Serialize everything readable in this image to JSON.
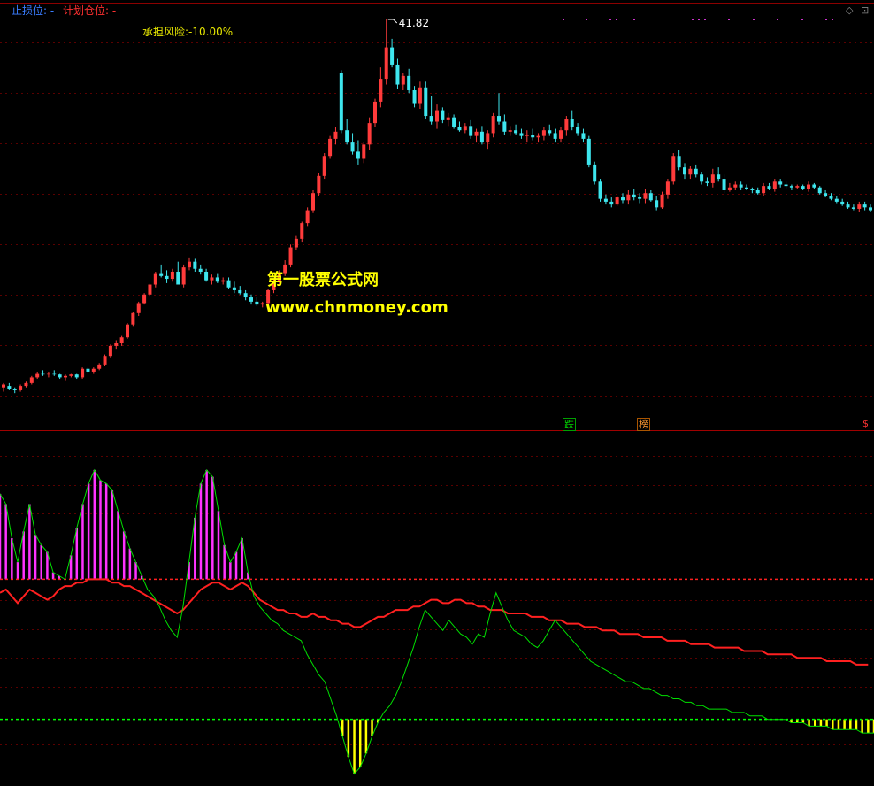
{
  "header": {
    "stop_loss_label": "止损位:",
    "stop_loss_value": "-",
    "plan_position_label": "计划仓位:",
    "plan_position_value": "-",
    "risk_text": "承担风险:-10.00%",
    "stop_loss_color": "#3a7dff",
    "plan_position_color": "#ff3030"
  },
  "watermark": {
    "name": "第一股票公式网",
    "url": "www.chnmoney.com"
  },
  "signals": {
    "fall": "跌",
    "list": "榜",
    "dollar": "$"
  },
  "window_controls": {
    "diamond": "◇",
    "maximize": "⊡"
  },
  "chart_data": [
    {
      "type": "candlestick",
      "max_label": "41.82",
      "ylim": [
        14,
        42.5
      ],
      "up_color": "#ff3b3b",
      "down_color": "#3ee6ee",
      "grid": true,
      "candles": [
        [
          16.0,
          16.3,
          15.7,
          16.2
        ],
        [
          16.1,
          16.3,
          15.8,
          15.9
        ],
        [
          15.9,
          16.0,
          15.6,
          15.8
        ],
        [
          15.8,
          16.2,
          15.7,
          16.1
        ],
        [
          16.1,
          16.4,
          16.0,
          16.3
        ],
        [
          16.3,
          16.8,
          16.2,
          16.7
        ],
        [
          16.7,
          17.1,
          16.6,
          17.0
        ],
        [
          17.0,
          17.2,
          16.8,
          16.9
        ],
        [
          16.9,
          17.1,
          16.7,
          17.0
        ],
        [
          17.0,
          17.2,
          16.8,
          16.9
        ],
        [
          16.9,
          17.0,
          16.6,
          16.7
        ],
        [
          16.7,
          16.9,
          16.5,
          16.8
        ],
        [
          16.8,
          17.0,
          16.7,
          16.9
        ],
        [
          16.9,
          17.0,
          16.6,
          16.7
        ],
        [
          16.7,
          17.4,
          16.6,
          17.3
        ],
        [
          17.3,
          17.4,
          17.0,
          17.1
        ],
        [
          17.1,
          17.4,
          17.0,
          17.3
        ],
        [
          17.3,
          17.7,
          17.2,
          17.6
        ],
        [
          17.6,
          18.3,
          17.5,
          18.2
        ],
        [
          18.2,
          19.0,
          18.1,
          18.9
        ],
        [
          18.9,
          19.3,
          18.7,
          19.1
        ],
        [
          19.1,
          19.6,
          18.9,
          19.5
        ],
        [
          19.5,
          20.5,
          19.4,
          20.4
        ],
        [
          20.4,
          21.3,
          20.3,
          21.2
        ],
        [
          21.2,
          22.0,
          21.0,
          21.9
        ],
        [
          21.9,
          22.6,
          21.8,
          22.5
        ],
        [
          22.5,
          23.3,
          22.3,
          23.2
        ],
        [
          23.2,
          24.1,
          23.0,
          24.0
        ],
        [
          24.0,
          24.6,
          23.7,
          23.8
        ],
        [
          23.8,
          24.2,
          23.3,
          23.6
        ],
        [
          23.6,
          24.3,
          23.4,
          24.1
        ],
        [
          24.1,
          24.8,
          23.5,
          23.2
        ],
        [
          23.2,
          24.6,
          23.0,
          24.4
        ],
        [
          24.4,
          25.1,
          24.2,
          24.8
        ],
        [
          24.8,
          25.0,
          24.1,
          24.3
        ],
        [
          24.3,
          24.6,
          23.9,
          24.1
        ],
        [
          24.1,
          24.3,
          23.4,
          23.5
        ],
        [
          23.5,
          23.9,
          23.2,
          23.7
        ],
        [
          23.7,
          24.0,
          23.3,
          23.4
        ],
        [
          23.4,
          23.7,
          23.2,
          23.5
        ],
        [
          23.5,
          23.7,
          22.9,
          23.0
        ],
        [
          23.0,
          23.4,
          22.6,
          22.8
        ],
        [
          22.8,
          23.1,
          22.5,
          22.6
        ],
        [
          22.6,
          22.8,
          22.1,
          22.3
        ],
        [
          22.3,
          22.5,
          21.8,
          22.0
        ],
        [
          22.0,
          22.3,
          21.7,
          21.8
        ],
        [
          21.8,
          22.0,
          21.6,
          21.9
        ],
        [
          21.9,
          22.9,
          21.8,
          22.8
        ],
        [
          22.8,
          23.6,
          22.6,
          23.4
        ],
        [
          23.4,
          24.2,
          23.2,
          24.0
        ],
        [
          24.0,
          24.9,
          23.8,
          24.6
        ],
        [
          24.6,
          26.0,
          24.4,
          25.8
        ],
        [
          25.8,
          26.6,
          25.6,
          26.4
        ],
        [
          26.4,
          27.6,
          26.2,
          27.5
        ],
        [
          27.5,
          28.6,
          27.3,
          28.4
        ],
        [
          28.4,
          29.8,
          28.2,
          29.6
        ],
        [
          29.6,
          31.0,
          29.4,
          30.8
        ],
        [
          30.8,
          32.4,
          30.6,
          32.2
        ],
        [
          32.2,
          33.6,
          32.0,
          33.4
        ],
        [
          33.4,
          34.2,
          33.0,
          33.9
        ],
        [
          38.0,
          38.2,
          33.8,
          34.0
        ],
        [
          34.0,
          34.8,
          33.0,
          33.2
        ],
        [
          33.2,
          33.8,
          32.3,
          32.5
        ],
        [
          32.5,
          33.3,
          31.6,
          32.0
        ],
        [
          32.0,
          33.2,
          31.7,
          33.0
        ],
        [
          33.0,
          34.9,
          32.6,
          34.5
        ],
        [
          34.5,
          36.2,
          34.2,
          36.0
        ],
        [
          36.0,
          38.4,
          35.6,
          37.6
        ],
        [
          37.6,
          41.82,
          37.2,
          39.8
        ],
        [
          39.8,
          40.4,
          38.4,
          38.6
        ],
        [
          38.6,
          39.0,
          36.9,
          37.2
        ],
        [
          37.2,
          38.0,
          36.8,
          37.8
        ],
        [
          37.8,
          38.3,
          36.6,
          36.8
        ],
        [
          36.8,
          37.1,
          35.6,
          35.9
        ],
        [
          35.9,
          37.4,
          35.5,
          37.0
        ],
        [
          37.0,
          37.4,
          34.8,
          35.0
        ],
        [
          35.0,
          36.4,
          34.4,
          34.6
        ],
        [
          34.6,
          35.8,
          34.1,
          35.4
        ],
        [
          35.4,
          35.6,
          34.5,
          34.7
        ],
        [
          34.7,
          35.2,
          34.3,
          34.9
        ],
        [
          34.9,
          35.1,
          34.1,
          34.2
        ],
        [
          34.2,
          34.6,
          33.9,
          34.0
        ],
        [
          34.0,
          34.5,
          33.8,
          34.3
        ],
        [
          34.3,
          34.7,
          33.4,
          33.6
        ],
        [
          33.6,
          34.1,
          33.2,
          33.9
        ],
        [
          33.9,
          34.3,
          33.0,
          33.2
        ],
        [
          33.2,
          34.0,
          32.7,
          33.8
        ],
        [
          33.8,
          35.2,
          33.5,
          35.0
        ],
        [
          35.0,
          36.6,
          34.4,
          34.6
        ],
        [
          34.6,
          35.1,
          33.7,
          33.9
        ],
        [
          33.9,
          34.3,
          33.6,
          34.0
        ],
        [
          34.0,
          34.4,
          33.7,
          33.8
        ],
        [
          33.8,
          34.1,
          33.4,
          33.6
        ],
        [
          33.6,
          34.0,
          33.2,
          33.7
        ],
        [
          33.7,
          34.1,
          33.3,
          33.5
        ],
        [
          33.5,
          33.8,
          33.2,
          33.6
        ],
        [
          33.6,
          34.2,
          33.3,
          34.0
        ],
        [
          34.0,
          34.4,
          33.6,
          33.8
        ],
        [
          33.8,
          34.1,
          33.2,
          33.4
        ],
        [
          33.4,
          34.2,
          33.2,
          34.0
        ],
        [
          34.0,
          35.0,
          33.6,
          34.8
        ],
        [
          34.8,
          35.4,
          34.0,
          34.2
        ],
        [
          34.2,
          34.5,
          33.6,
          33.8
        ],
        [
          33.8,
          34.1,
          33.2,
          33.4
        ],
        [
          33.4,
          33.6,
          31.4,
          31.6
        ],
        [
          31.6,
          31.8,
          30.2,
          30.4
        ],
        [
          30.4,
          30.6,
          29.0,
          29.2
        ],
        [
          29.2,
          29.5,
          28.8,
          29.0
        ],
        [
          29.0,
          29.3,
          28.6,
          28.8
        ],
        [
          28.8,
          29.4,
          28.7,
          29.3
        ],
        [
          29.3,
          29.6,
          28.9,
          29.1
        ],
        [
          29.1,
          29.8,
          28.8,
          29.5
        ],
        [
          29.5,
          29.9,
          29.1,
          29.3
        ],
        [
          29.3,
          29.6,
          28.9,
          29.2
        ],
        [
          29.2,
          29.9,
          28.9,
          29.6
        ],
        [
          29.6,
          29.8,
          29.0,
          29.1
        ],
        [
          29.1,
          29.4,
          28.4,
          28.6
        ],
        [
          28.6,
          29.7,
          28.5,
          29.5
        ],
        [
          29.5,
          30.6,
          29.2,
          30.4
        ],
        [
          30.4,
          32.4,
          30.2,
          32.2
        ],
        [
          32.2,
          32.6,
          31.2,
          31.4
        ],
        [
          31.4,
          31.7,
          30.6,
          30.9
        ],
        [
          30.9,
          31.5,
          30.6,
          31.3
        ],
        [
          31.3,
          31.6,
          30.7,
          30.9
        ],
        [
          30.9,
          31.1,
          30.2,
          30.4
        ],
        [
          30.4,
          30.7,
          30.1,
          30.3
        ],
        [
          30.3,
          31.3,
          30.0,
          30.9
        ],
        [
          30.9,
          31.4,
          30.4,
          30.6
        ],
        [
          30.6,
          30.9,
          29.6,
          29.8
        ],
        [
          29.8,
          30.3,
          29.7,
          30.0
        ],
        [
          30.0,
          30.4,
          29.8,
          30.2
        ],
        [
          30.2,
          30.4,
          29.8,
          30.0
        ],
        [
          30.0,
          30.2,
          29.8,
          29.9
        ],
        [
          29.9,
          30.0,
          29.6,
          29.8
        ],
        [
          29.8,
          30.0,
          29.5,
          29.6
        ],
        [
          29.6,
          30.3,
          29.4,
          30.1
        ],
        [
          30.1,
          30.3,
          29.8,
          29.9
        ],
        [
          29.9,
          30.6,
          29.7,
          30.4
        ],
        [
          30.4,
          30.6,
          30.0,
          30.2
        ],
        [
          30.2,
          30.4,
          29.9,
          30.1
        ],
        [
          30.1,
          30.2,
          29.8,
          30.0
        ],
        [
          30.0,
          30.2,
          29.9,
          30.1
        ],
        [
          30.1,
          30.2,
          29.8,
          29.9
        ],
        [
          29.9,
          30.4,
          29.7,
          30.2
        ],
        [
          30.2,
          30.3,
          29.9,
          30.0
        ],
        [
          30.0,
          30.1,
          29.5,
          29.6
        ],
        [
          29.6,
          29.8,
          29.3,
          29.4
        ],
        [
          29.4,
          29.6,
          29.1,
          29.2
        ],
        [
          29.2,
          29.4,
          28.9,
          29.0
        ],
        [
          29.0,
          29.2,
          28.7,
          28.8
        ],
        [
          28.8,
          29.0,
          28.5,
          28.6
        ],
        [
          28.6,
          28.8,
          28.4,
          28.5
        ],
        [
          28.5,
          29.0,
          28.3,
          28.8
        ],
        [
          28.8,
          29.0,
          28.4,
          28.6
        ],
        [
          28.6,
          28.8,
          28.3,
          28.4
        ]
      ]
    },
    {
      "type": "bar+line",
      "ylim": [
        0,
        100
      ],
      "upper_threshold": 60,
      "lower_threshold": 19,
      "series": [
        {
          "role": "fast",
          "color_line": "#00e000",
          "color_bar_above": "#ff33ff",
          "color_bar_below": "#ffff00",
          "values": [
            85,
            82,
            72,
            65,
            74,
            82,
            73,
            70,
            68,
            62,
            61,
            60,
            67,
            75,
            82,
            88,
            92,
            89,
            88,
            86,
            80,
            74,
            69,
            65,
            61,
            57,
            55,
            52,
            48,
            45,
            43,
            52,
            65,
            78,
            88,
            92,
            90,
            80,
            70,
            65,
            68,
            72,
            62,
            55,
            52,
            50,
            48,
            47,
            45,
            44,
            43,
            42,
            38,
            35,
            32,
            30,
            25,
            20,
            14,
            8,
            3,
            5,
            9,
            14,
            18,
            21,
            23,
            26,
            30,
            35,
            40,
            46,
            51,
            49,
            47,
            45,
            48,
            46,
            44,
            43,
            41,
            44,
            43,
            50,
            56,
            52,
            48,
            45,
            44,
            43,
            41,
            40,
            42,
            45,
            48,
            46,
            44,
            42,
            40,
            38,
            36,
            35,
            34,
            33,
            32,
            31,
            30,
            30,
            29,
            28,
            28,
            27,
            26,
            26,
            25,
            25,
            24,
            24,
            23,
            23,
            22,
            22,
            22,
            22,
            21,
            21,
            21,
            20,
            20,
            20,
            19,
            19,
            19,
            19,
            18,
            18,
            18,
            17,
            17,
            17,
            17,
            16,
            16,
            16,
            16,
            16,
            15,
            15,
            15
          ]
        },
        {
          "role": "slow",
          "color": "#ff2020",
          "values": [
            56,
            57,
            55,
            53,
            55,
            57,
            56,
            55,
            54,
            55,
            57,
            58,
            58,
            59,
            59,
            60,
            60,
            60,
            60,
            59,
            59,
            58,
            58,
            57,
            56,
            55,
            54,
            53,
            52,
            51,
            50,
            51,
            53,
            55,
            57,
            58,
            59,
            59,
            58,
            57,
            58,
            59,
            58,
            56,
            54,
            53,
            52,
            51,
            51,
            50,
            50,
            49,
            49,
            50,
            49,
            49,
            48,
            48,
            47,
            47,
            46,
            46,
            47,
            48,
            49,
            49,
            50,
            51,
            51,
            51,
            52,
            52,
            53,
            54,
            54,
            53,
            53,
            54,
            54,
            53,
            53,
            52,
            52,
            51,
            51,
            51,
            50,
            50,
            50,
            50,
            49,
            49,
            49,
            48,
            48,
            48,
            47,
            47,
            47,
            46,
            46,
            46,
            45,
            45,
            45,
            44,
            44,
            44,
            44,
            43,
            43,
            43,
            43,
            42,
            42,
            42,
            42,
            41,
            41,
            41,
            41,
            40,
            40,
            40,
            40,
            40,
            39,
            39,
            39,
            39,
            38,
            38,
            38,
            38,
            38,
            37,
            37,
            37,
            37,
            37,
            36,
            36,
            36,
            36,
            36,
            35,
            35,
            35
          ]
        }
      ]
    }
  ]
}
